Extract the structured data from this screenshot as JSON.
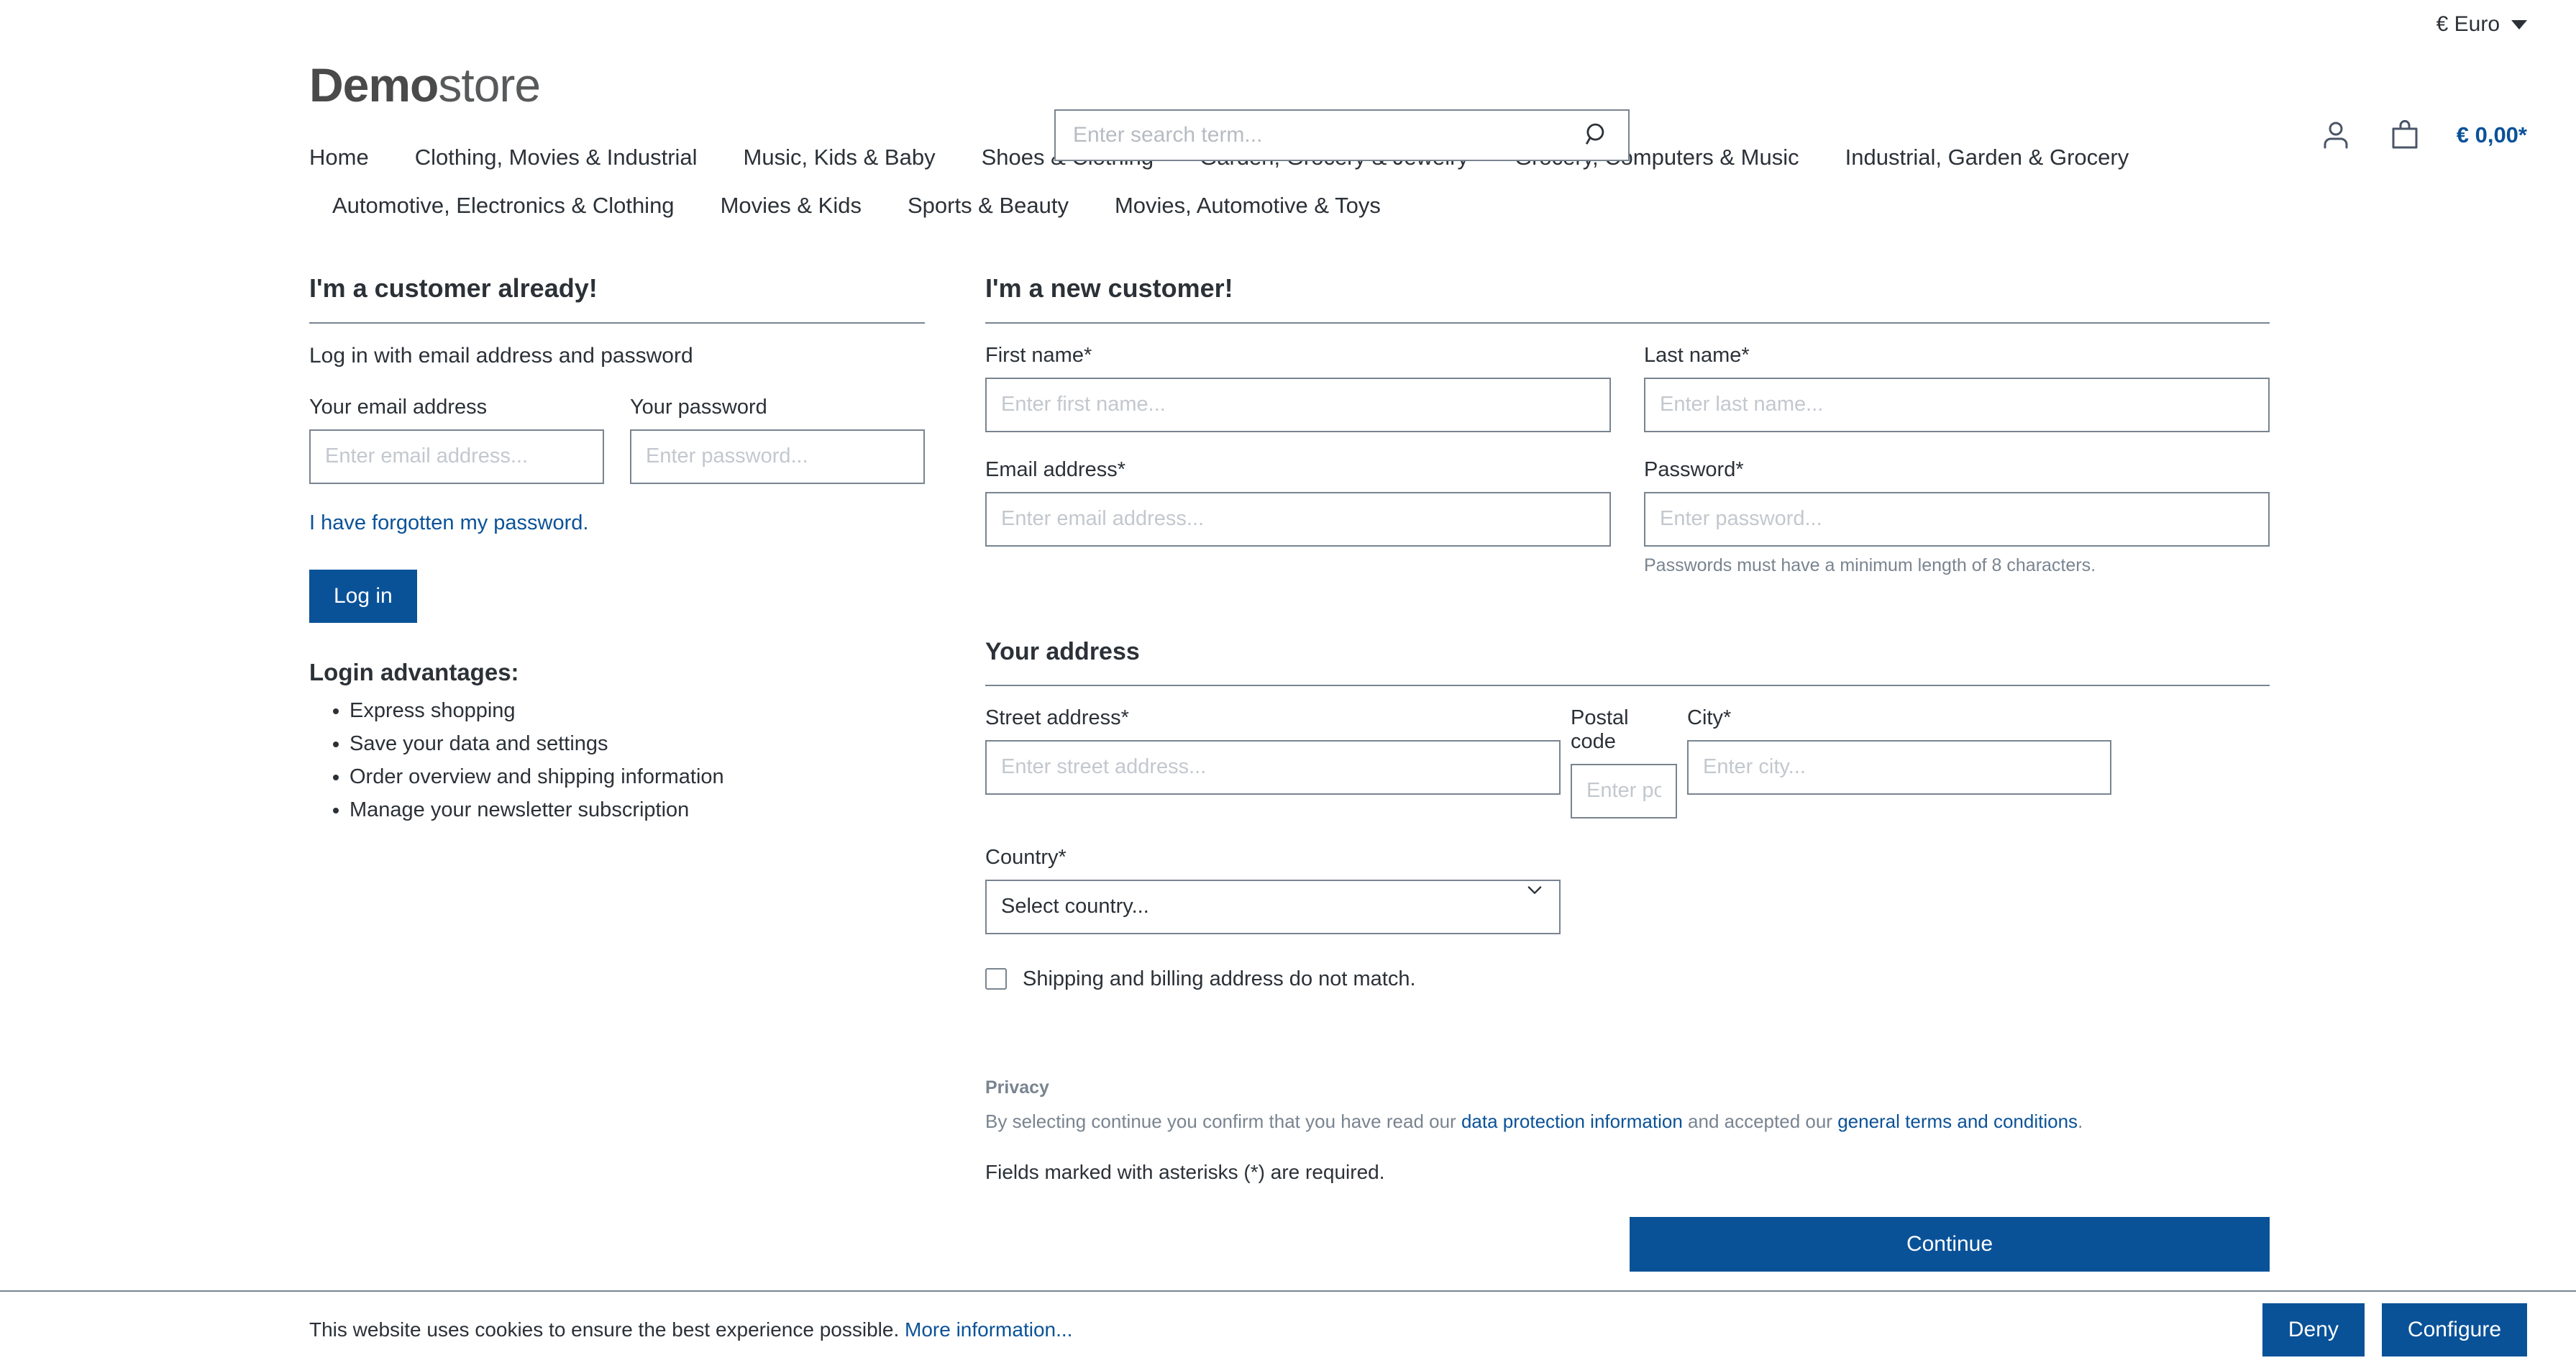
{
  "topbar": {
    "currency_label": "€ Euro"
  },
  "header": {
    "logo_bold": "Demo",
    "logo_light": "store",
    "search_placeholder": "Enter search term...",
    "search_value": "",
    "cart_total": "€ 0,00*"
  },
  "nav": {
    "items": [
      {
        "label": "Home"
      },
      {
        "label": "Clothing, Movies & Industrial"
      },
      {
        "label": "Music, Kids & Baby"
      },
      {
        "label": "Shoes & Clothing"
      },
      {
        "label": "Garden, Grocery & Jewelry"
      },
      {
        "label": "Grocery, Computers & Music"
      },
      {
        "label": "Industrial, Garden & Grocery"
      },
      {
        "label": "Automotive, Electronics & Clothing"
      },
      {
        "label": "Movies & Kids"
      },
      {
        "label": "Sports & Beauty"
      },
      {
        "label": "Movies, Automotive & Toys"
      }
    ]
  },
  "login": {
    "title": "I'm a customer already!",
    "subtitle": "Log in with email address and password",
    "email_label": "Your email address",
    "email_placeholder": "Enter email address...",
    "email_value": "",
    "password_label": "Your password",
    "password_placeholder": "Enter password...",
    "password_value": "",
    "forgot_link": "I have forgotten my password.",
    "login_button": "Log in",
    "advantages_title": "Login advantages:",
    "advantages": [
      "Express shopping",
      "Save your data and settings",
      "Order overview and shipping information",
      "Manage your newsletter subscription"
    ]
  },
  "register": {
    "title": "I'm a new customer!",
    "first_name_label": "First name*",
    "first_name_placeholder": "Enter first name...",
    "first_name_value": "",
    "last_name_label": "Last name*",
    "last_name_placeholder": "Enter last name...",
    "last_name_value": "",
    "email_label": "Email address*",
    "email_placeholder": "Enter email address...",
    "email_value": "",
    "password_label": "Password*",
    "password_placeholder": "Enter password...",
    "password_value": "",
    "password_hint": "Passwords must have a minimum length of 8 characters.",
    "address_title": "Your address",
    "street_label": "Street address*",
    "street_placeholder": "Enter street address...",
    "street_value": "",
    "postal_label": "Postal code",
    "postal_placeholder": "Enter postal code...",
    "postal_value": "",
    "city_label": "City*",
    "city_placeholder": "Enter city...",
    "city_value": "",
    "country_label": "Country*",
    "country_selected": "Select country...",
    "shipping_checkbox_label": "Shipping and billing address do not match.",
    "shipping_checkbox_checked": false,
    "privacy_heading": "Privacy",
    "privacy_prefix": "By selecting continue you confirm that you have read our ",
    "privacy_link1": "data protection information",
    "privacy_middle": " and accepted our ",
    "privacy_link2": "general terms and conditions",
    "privacy_suffix": ".",
    "required_note": "Fields marked with asterisks (*) are required.",
    "continue_button": "Continue"
  },
  "cookie_bar": {
    "text": "This website uses cookies to ensure the best experience possible.",
    "more_link": "More information...",
    "deny_button": "Deny",
    "configure_button": "Configure"
  },
  "colors": {
    "accent_blue": "#0a5298",
    "border_gray": "#798490",
    "text_dark": "#2b3137",
    "placeholder_gray": "#c3c8ce"
  }
}
